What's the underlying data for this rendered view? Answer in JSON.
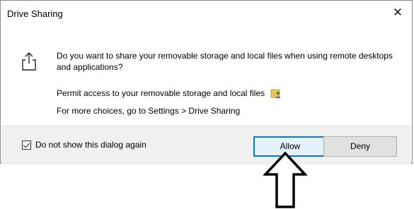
{
  "dialog": {
    "title": "Drive Sharing",
    "close_label": "✕",
    "question": "Do you want to share your removable storage and local files when using remote desktops and applications?",
    "permit_text": "Permit access to your removable storage and local files",
    "more_choices": "For more choices, go to Settings > Drive Sharing",
    "checkbox_label": "Do not show this dialog again",
    "checkbox_checked": true,
    "allow_label": "Allow",
    "deny_label": "Deny",
    "accent_color": "#0078d7"
  }
}
